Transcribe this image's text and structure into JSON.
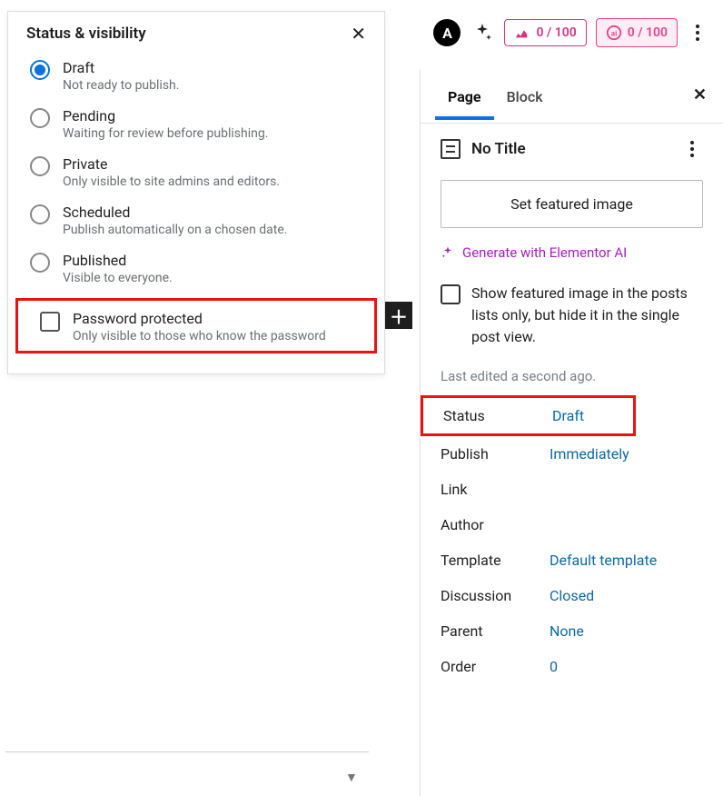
{
  "topbar": {
    "astra_letter": "A",
    "score1": "0 / 100",
    "score2": "0 / 100"
  },
  "popover": {
    "title": "Status & visibility",
    "options": [
      {
        "label": "Draft",
        "desc": "Not ready to publish.",
        "selected": true
      },
      {
        "label": "Pending",
        "desc": "Waiting for review before publishing.",
        "selected": false
      },
      {
        "label": "Private",
        "desc": "Only visible to site admins and editors.",
        "selected": false
      },
      {
        "label": "Scheduled",
        "desc": "Publish automatically on a chosen date.",
        "selected": false
      },
      {
        "label": "Published",
        "desc": "Visible to everyone.",
        "selected": false
      }
    ],
    "password": {
      "label": "Password protected",
      "desc": "Only visible to those who know the password"
    }
  },
  "sidebar": {
    "tabs": {
      "page": "Page",
      "block": "Block"
    },
    "doc_title": "No Title",
    "featured_btn": "Set featured image",
    "ai_text": "Generate with Elementor AI",
    "featured_checkbox_text": "Show featured image in the posts lists only, but hide it in the single post view.",
    "last_edited": "Last edited a second ago.",
    "meta": {
      "status_label": "Status",
      "status_value": "Draft",
      "publish_label": "Publish",
      "publish_value": "Immediately",
      "link_label": "Link",
      "author_label": "Author",
      "template_label": "Template",
      "template_value": "Default template",
      "discussion_label": "Discussion",
      "discussion_value": "Closed",
      "parent_label": "Parent",
      "parent_value": "None",
      "order_label": "Order",
      "order_value": "0"
    }
  }
}
